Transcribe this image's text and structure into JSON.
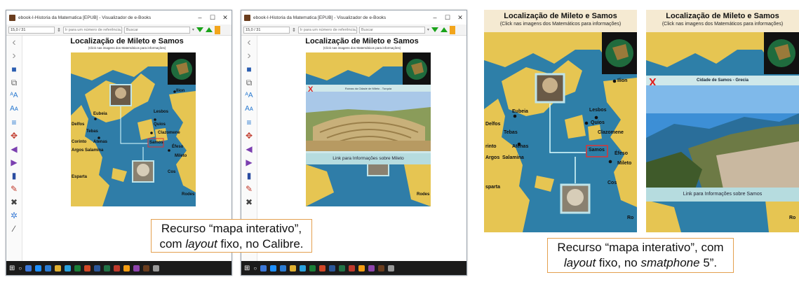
{
  "calibre": {
    "window_title": "ebook-I-Historia da Matematica [EPUB] - Visualizador de e-Books",
    "page_counter": "15,0 / 31",
    "ref_placeholder": "Ir para um número de referência...",
    "search_placeholder": "Buscar",
    "map_title": "Localização de Mileto e Samos",
    "map_subtitle": "(Click nas imagens dos Matemáticos para informações)",
    "popup_title": "Ruínas da Cidade de Mileto - Turquia",
    "popup_link": "Link para Informações sobre Mileto",
    "close_mark": "X",
    "place_labels": {
      "ilion": "Ilion",
      "lesbos": "Lesbos",
      "eubeia": "Eubeia",
      "delfos": "Delfos",
      "tebas": "Tebas",
      "atenas": "Atenas",
      "corinto": "Corinto",
      "argos": "Argos",
      "salamina": "Salamina",
      "esparta": "Esparta",
      "quios": "Quios",
      "clazomene": "Clazomene",
      "efeso": "Éfeso",
      "samos": "Samos",
      "mileto": "Mileto",
      "cos": "Cos",
      "rodes": "Rodes"
    }
  },
  "phone": {
    "map_title": "Localização de Mileto e Samos",
    "map_subtitle": "(Click nas imagens dos Matemáticos para informações)",
    "popup_title": "Cidade de Samos - Grecia",
    "popup_link": "Link para Informações sobre Samos",
    "close_mark": "X",
    "place_labels": {
      "ilion": "Ilion",
      "lesbos": "Lesbos",
      "eubeia": "Eubeia",
      "delfos": "Delfos",
      "tebas": "Tebas",
      "atenas": "Atenas",
      "corinto": "rinto",
      "argos": "Argos",
      "salamina": "Salamina",
      "esparta": "sparta",
      "quios": "Quios",
      "clazomene": "Clazomene",
      "efeso": "Éfeso",
      "samos": "Samos",
      "mileto": "Mileto",
      "cos": "Cos",
      "rodes": "Ro"
    }
  },
  "callouts": {
    "calibre_line1": "Recurso “mapa interativo”,",
    "calibre_line2_pre": "com ",
    "calibre_line2_em": "layout",
    "calibre_line2_post": " fixo, no Calibre.",
    "phone_line1": "Recurso “mapa interativo”, com",
    "phone_line2_em1": "layout",
    "phone_line2_mid": " fixo, no ",
    "phone_line2_em2": "smatphone",
    "phone_line2_post": " 5”."
  },
  "colors": {
    "sea": "#2f7da8",
    "land": "#e6c552",
    "accent_green": "#1aa31a",
    "callout_border": "#e4a04f",
    "close_red": "#e02020"
  }
}
